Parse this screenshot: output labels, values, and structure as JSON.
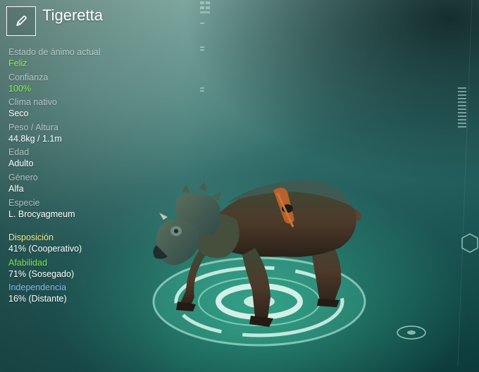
{
  "creature": {
    "name": "Tigeretta",
    "edit_icon": "pencil-icon"
  },
  "stats": [
    {
      "label": "Estado de ánimo actual",
      "value": "Feliz"
    },
    {
      "label": "Confianza",
      "value": "100%"
    },
    {
      "label": "Clima nativo",
      "value": "Seco"
    },
    {
      "label": "Peso / Altura",
      "value": "44.8kg / 1.1m"
    },
    {
      "label": "Edad",
      "value": "Adulto"
    },
    {
      "label": "Género",
      "value": "Alfa"
    },
    {
      "label": "Especie",
      "value": "L. Brocyagmeum"
    }
  ],
  "traits": [
    {
      "label": "Disposición",
      "value": "41% (Cooperativo)"
    },
    {
      "label": "Afabilidad",
      "value": "71% (Sosegado)"
    },
    {
      "label": "Independencia",
      "value": "16% (Distante)"
    }
  ],
  "colors": {
    "mood_value": "#8cf05a",
    "trust_value": "#8cf05a",
    "disposition_label": "#f3e98a",
    "affability_label": "#7fe24f",
    "independence_label": "#8ab8ee"
  }
}
